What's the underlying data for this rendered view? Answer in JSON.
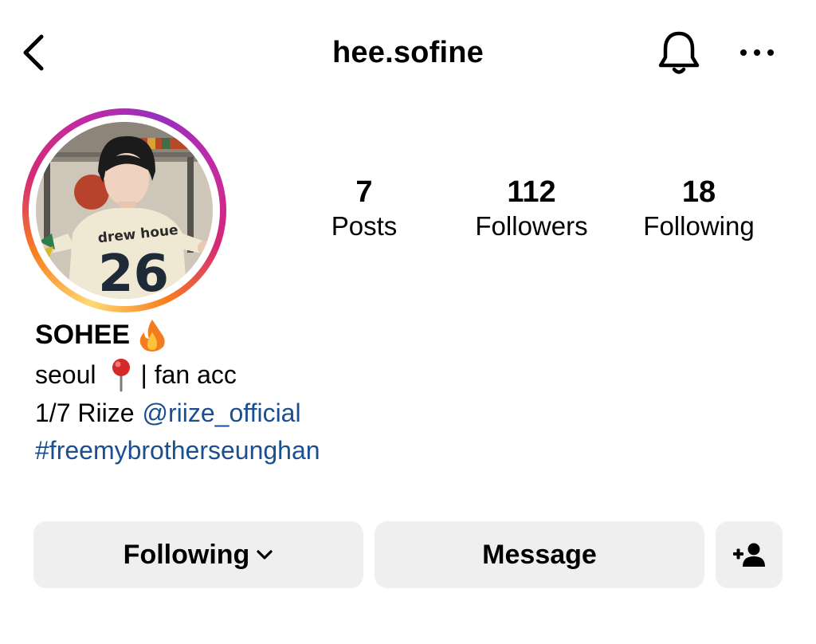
{
  "header": {
    "username": "hee.sofine",
    "icons": {
      "back": "chevron-left-icon",
      "notifications": "bell-icon",
      "more": "more-horizontal-icon"
    }
  },
  "profile": {
    "avatar": "profile-photo",
    "story_ring_colors": [
      "#feda75",
      "#fa7e1e",
      "#d62976",
      "#962fbf"
    ]
  },
  "stats": [
    {
      "value": "7",
      "label": "Posts"
    },
    {
      "value": "112",
      "label": "Followers"
    },
    {
      "value": "18",
      "label": "Following"
    }
  ],
  "bio": {
    "name": "SOHEE",
    "name_emoji": "fire-emoji",
    "line1_a": "seoul",
    "line1_emoji": "pushpin-emoji",
    "line1_b": "| fan acc",
    "line2_text": "1/7 Riize",
    "line2_mention": "@riize_official",
    "line3_hashtag": "#freemybrotherseunghan",
    "link_color": "#1b4f8f"
  },
  "actions": {
    "following_label": "Following",
    "message_label": "Message",
    "add_user_icon": "add-user-icon",
    "button_bg": "#efefef"
  }
}
